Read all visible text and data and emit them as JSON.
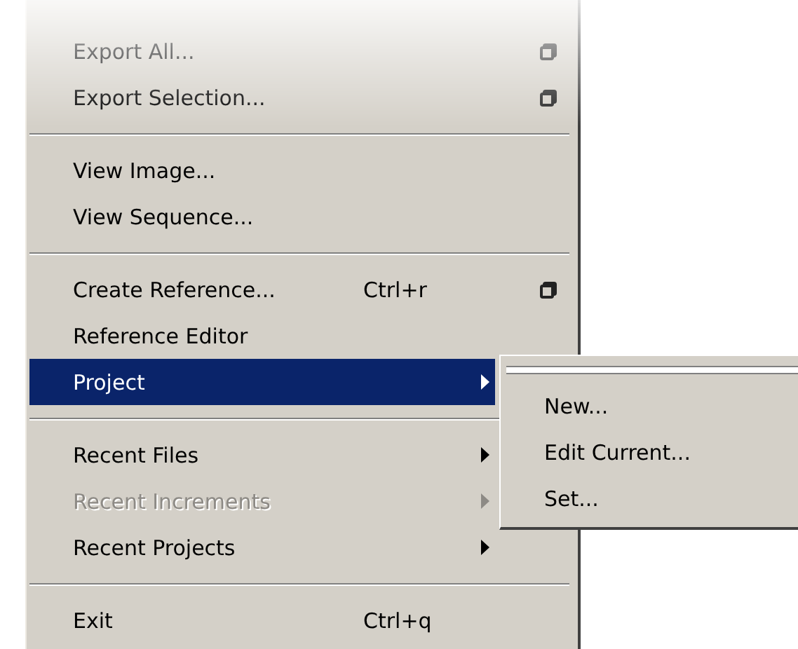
{
  "menu": {
    "items": [
      {
        "kind": "item",
        "label": "Export All...",
        "disabled": false,
        "selected": false,
        "option_box": true
      },
      {
        "kind": "item",
        "label": "Export Selection...",
        "disabled": false,
        "selected": false,
        "option_box": true
      },
      {
        "kind": "separator"
      },
      {
        "kind": "item",
        "label": "View Image...",
        "disabled": false,
        "selected": false
      },
      {
        "kind": "item",
        "label": "View Sequence...",
        "disabled": false,
        "selected": false
      },
      {
        "kind": "separator"
      },
      {
        "kind": "item",
        "label": "Create Reference...",
        "shortcut": "Ctrl+r",
        "disabled": false,
        "selected": false,
        "option_box": true
      },
      {
        "kind": "item",
        "label": "Reference Editor",
        "disabled": false,
        "selected": false
      },
      {
        "kind": "item",
        "label": "Project",
        "disabled": false,
        "selected": true,
        "submenu": true
      },
      {
        "kind": "separator"
      },
      {
        "kind": "item",
        "label": "Recent Files",
        "disabled": false,
        "selected": false,
        "submenu": true
      },
      {
        "kind": "item",
        "label": "Recent Increments",
        "disabled": true,
        "selected": false,
        "submenu": true
      },
      {
        "kind": "item",
        "label": "Recent Projects",
        "disabled": false,
        "selected": false,
        "submenu": true
      },
      {
        "kind": "separator"
      },
      {
        "kind": "item",
        "label": "Exit",
        "shortcut": "Ctrl+q",
        "disabled": false,
        "selected": false
      }
    ]
  },
  "submenu": {
    "tear_off": true,
    "items": [
      {
        "label": "New..."
      },
      {
        "label": "Edit Current..."
      },
      {
        "label": "Set..."
      }
    ]
  }
}
